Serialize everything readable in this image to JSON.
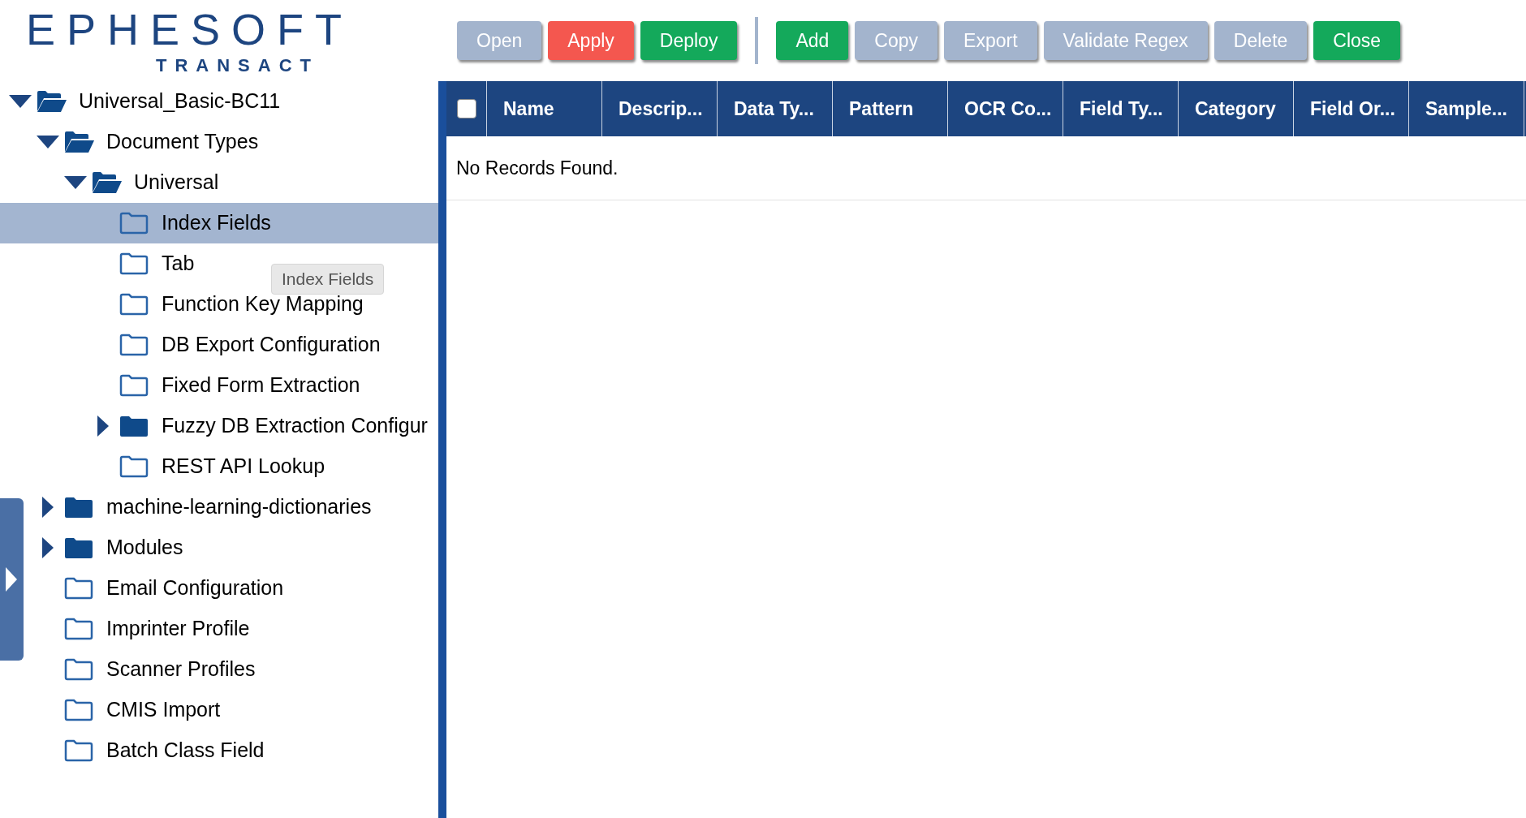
{
  "logo": {
    "name": "EPHESOFT",
    "product": "TRANSACT"
  },
  "tree": [
    {
      "label": "Universal_Basic-BC11",
      "kind": "branch",
      "expanded": true,
      "selected": false,
      "children": [
        {
          "label": "Document Types",
          "kind": "branch",
          "expanded": true,
          "selected": false,
          "children": [
            {
              "label": "Universal",
              "kind": "branch",
              "expanded": true,
              "selected": false,
              "children": [
                {
                  "label": "Index Fields",
                  "kind": "leaf",
                  "selected": true
                },
                {
                  "label": "Tab",
                  "kind": "leaf",
                  "selected": false,
                  "tooltip": "Index Fields"
                },
                {
                  "label": "Function Key Mapping",
                  "kind": "leaf",
                  "selected": false
                },
                {
                  "label": "DB Export Configuration",
                  "kind": "leaf",
                  "selected": false
                },
                {
                  "label": "Fixed Form Extraction",
                  "kind": "leaf",
                  "selected": false
                },
                {
                  "label": "Fuzzy DB Extraction Configur",
                  "kind": "branch",
                  "expanded": false,
                  "selected": false
                },
                {
                  "label": "REST API Lookup",
                  "kind": "leaf",
                  "selected": false
                }
              ]
            }
          ]
        },
        {
          "label": "machine-learning-dictionaries",
          "kind": "branch",
          "expanded": false,
          "selected": false
        },
        {
          "label": "Modules",
          "kind": "branch",
          "expanded": false,
          "selected": false
        },
        {
          "label": "Email Configuration",
          "kind": "leaf",
          "selected": false
        },
        {
          "label": "Imprinter Profile",
          "kind": "leaf",
          "selected": false
        },
        {
          "label": "Scanner Profiles",
          "kind": "leaf",
          "selected": false
        },
        {
          "label": "CMIS Import",
          "kind": "leaf",
          "selected": false
        },
        {
          "label": "Batch Class Field",
          "kind": "leaf",
          "selected": false
        }
      ]
    }
  ],
  "toolbar": [
    [
      {
        "label": "Open",
        "disabled": true
      },
      {
        "label": "Apply",
        "kind": "danger",
        "disabled": false
      },
      {
        "label": "Deploy",
        "kind": "success",
        "disabled": false
      }
    ],
    [
      {
        "label": "Add",
        "kind": "success",
        "disabled": false
      },
      {
        "label": "Copy",
        "disabled": true
      },
      {
        "label": "Export",
        "disabled": true
      },
      {
        "label": "Validate Regex",
        "disabled": true
      },
      {
        "label": "Delete",
        "disabled": true
      },
      {
        "label": "Close",
        "kind": "success",
        "disabled": false
      }
    ]
  ],
  "table": {
    "select_all": {
      "checked": false
    },
    "columns": [
      "Name",
      "Descrip...",
      "Data Ty...",
      "Pattern",
      "OCR Co...",
      "Field Ty...",
      "Category",
      "Field Or...",
      "Sample..."
    ],
    "empty_message": "No Records Found."
  }
}
